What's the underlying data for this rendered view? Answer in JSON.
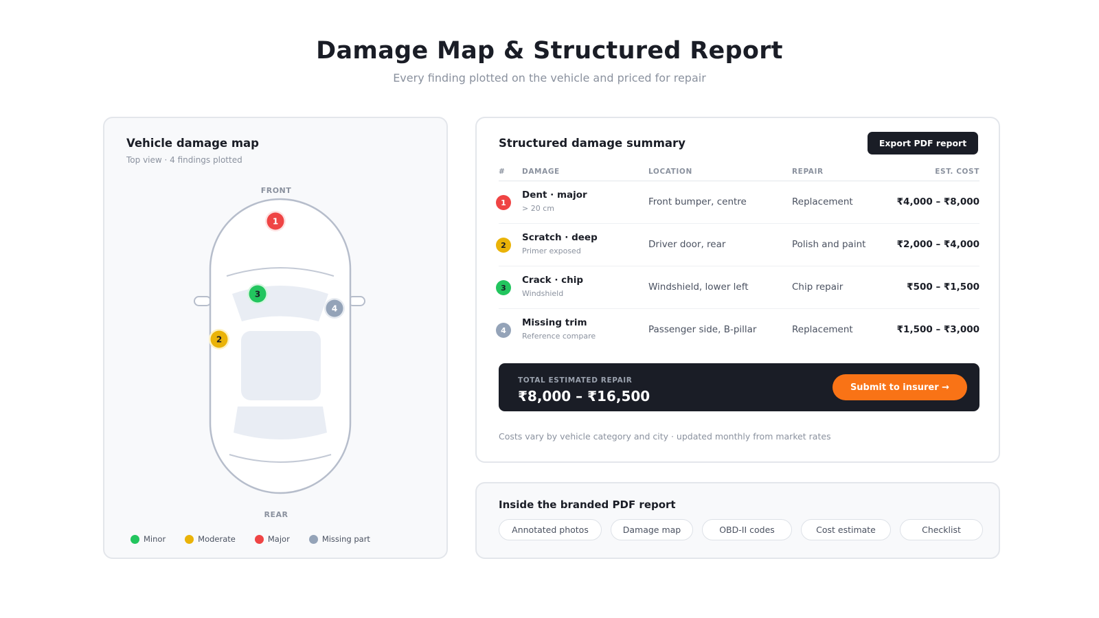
{
  "header": {
    "title": "Damage Map & Structured Report",
    "subtitle": "Every finding plotted on the vehicle and priced for repair"
  },
  "map": {
    "title": "Vehicle damage map",
    "subtitle": "Top view · 4 findings plotted",
    "front_label": "FRONT",
    "rear_label": "REAR",
    "markers": [
      {
        "number": "1",
        "severity": "major"
      },
      {
        "number": "2",
        "severity": "moderate"
      },
      {
        "number": "3",
        "severity": "minor"
      },
      {
        "number": "4",
        "severity": "missing"
      }
    ],
    "legend": [
      {
        "label": "Minor",
        "color": "#22c55e"
      },
      {
        "label": "Moderate",
        "color": "#eab308"
      },
      {
        "label": "Major",
        "color": "#ef4444"
      },
      {
        "label": "Missing part",
        "color": "#94a3b8"
      }
    ]
  },
  "summary": {
    "title": "Structured damage summary",
    "export_label": "Export PDF report",
    "columns": {
      "num": "#",
      "damage": "DAMAGE",
      "location": "LOCATION",
      "repair": "REPAIR",
      "cost": "EST. COST"
    },
    "rows": [
      {
        "num": "1",
        "color": "#ef4444",
        "title": "Dent · major",
        "sub": "> 20 cm",
        "location": "Front bumper, centre",
        "repair": "Replacement",
        "cost": "₹4,000 – ₹8,000"
      },
      {
        "num": "2",
        "color": "#eab308",
        "title": "Scratch · deep",
        "sub": "Primer exposed",
        "location": "Driver door, rear",
        "repair": "Polish and paint",
        "cost": "₹2,000 – ₹4,000"
      },
      {
        "num": "3",
        "color": "#22c55e",
        "title": "Crack · chip",
        "sub": "Windshield",
        "location": "Windshield, lower left",
        "repair": "Chip repair",
        "cost": "₹500 – ₹1,500"
      },
      {
        "num": "4",
        "color": "#94a3b8",
        "title": "Missing trim",
        "sub": "Reference compare",
        "location": "Passenger side, B-pillar",
        "repair": "Replacement",
        "cost": "₹1,500 – ₹3,000"
      }
    ],
    "total_label": "TOTAL ESTIMATED REPAIR",
    "total_value": "₹8,000 – ₹16,500",
    "submit_label": "Submit to insurer →",
    "footnote": "Costs vary by vehicle category and city · updated monthly from market rates"
  },
  "pdf": {
    "title": "Inside the branded PDF report",
    "chips": [
      "Annotated photos",
      "Damage map",
      "OBD-II codes",
      "Cost estimate",
      "Checklist"
    ]
  },
  "colors": {
    "major": "#ef4444",
    "moderate": "#eab308",
    "minor": "#22c55e",
    "missing": "#94a3b8",
    "accent": "#f97316",
    "dark": "#1a1d26"
  }
}
